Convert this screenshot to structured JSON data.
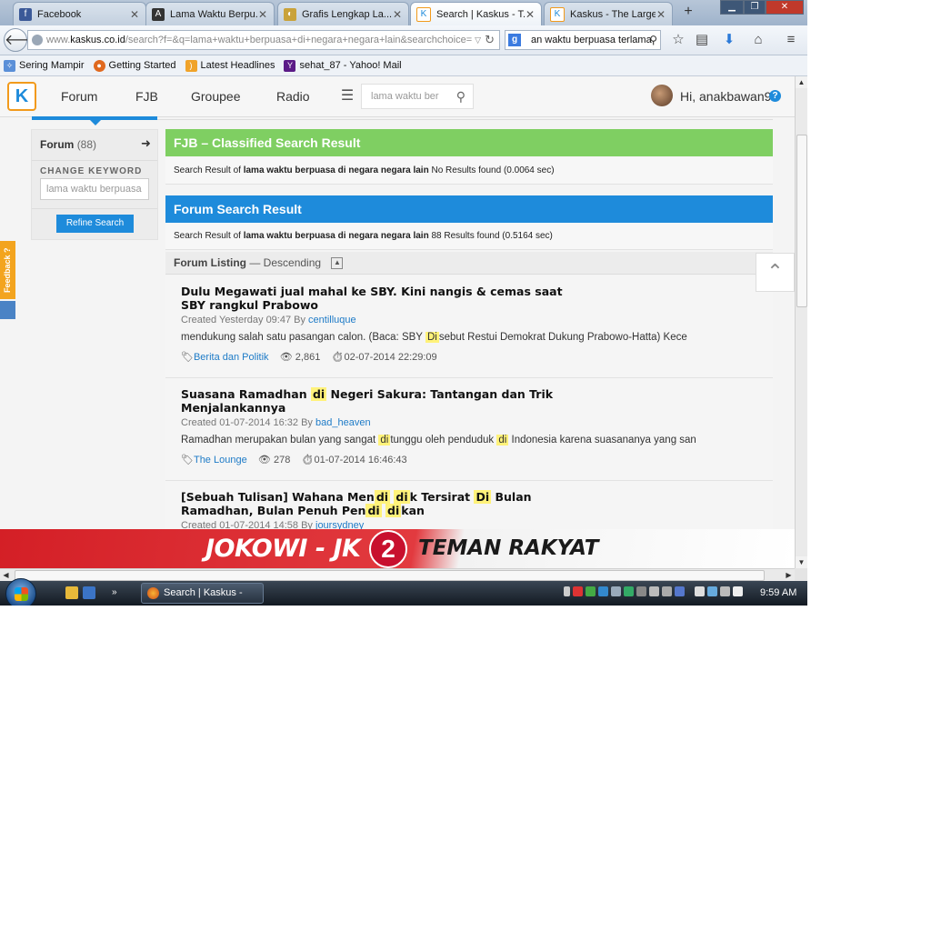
{
  "browser": {
    "tabs": [
      {
        "label": "Facebook",
        "icon": "facebook-icon",
        "active": false
      },
      {
        "label": "Lama Waktu Berpu...",
        "icon": "page-icon",
        "active": false
      },
      {
        "label": "Grafis Lengkap La...",
        "icon": "page-icon",
        "active": false
      },
      {
        "label": "Search | Kaskus - T...",
        "icon": "kaskus-icon",
        "active": true
      },
      {
        "label": "Kaskus - The Large...",
        "icon": "kaskus-icon",
        "active": false
      }
    ],
    "new_tab": "+",
    "url": {
      "prefix": "www.",
      "domain": "kaskus.co.id",
      "path": "/search?f=&q=lama+waktu+berpuasa+di+negara+negara+lain&searchchoice="
    },
    "search_value": "an waktu berpuasa terlama",
    "bookmarks": [
      "Sering Mampir",
      "Getting Started",
      "Latest Headlines",
      "sehat_87 - Yahoo! Mail"
    ]
  },
  "kaskus": {
    "nav": [
      "Forum",
      "FJB",
      "Groupee",
      "Radio"
    ],
    "search_placeholder": "lama waktu ber",
    "user_greeting": "Hi, anakbawan9",
    "help": "?"
  },
  "sidebar": {
    "forum_label": "Forum",
    "forum_count": "(88)",
    "change_keyword": "CHANGE KEYWORD",
    "keyword_value": "lama waktu berpuasa",
    "refine_button": "Refine Search"
  },
  "fjb": {
    "title": "FJB – Classified Search Result",
    "result_prefix": "Search Result of",
    "query": "lama waktu berpuasa di negara negara lain",
    "result_suffix": "No Results found (0.0064 sec)",
    "color": "#7fcf62"
  },
  "forum": {
    "title": "Forum Search Result",
    "result_prefix": "Search Result of",
    "query": "lama waktu berpuasa di negara negara lain",
    "result_suffix": "88 Results found (0.5164 sec)",
    "color": "#1e8bdb",
    "listing_label": "Forum Listing",
    "listing_order": "— Descending"
  },
  "results": [
    {
      "title": "Dulu Megawati jual mahal ke SBY. Kini nangis & cemas saat SBY rangkul Prabowo",
      "created": "Created Yesterday 09:47 By",
      "author": "centilluque",
      "snippet_before": "mendukung salah satu pasangan calon. (Baca: SBY ",
      "snippet_hl": "Di",
      "snippet_after": "sebut Restui Demokrat Dukung Prabowo-Hatta) Kece",
      "category": "Berita dan Politik",
      "views": "2,861",
      "date": "02-07-2014 22:29:09"
    },
    {
      "title_before": "Suasana Ramadhan ",
      "title_hl": "di",
      "title_after": " Negeri Sakura: Tantangan dan Trik Menjalankannya",
      "created": "Created 01-07-2014 16:32 By",
      "author": "bad_heaven",
      "snippet_a": "Ramadhan merupakan bulan yang sangat ",
      "snippet_hl1": "di",
      "snippet_b": "tunggu oleh penduduk ",
      "snippet_hl2": "di",
      "snippet_c": " Indonesia karena suasananya yang san",
      "category": "The Lounge",
      "views": "278",
      "date": "01-07-2014 16:46:43"
    },
    {
      "t1": "[Sebuah Tulisan] Wahana Men",
      "h1": "di",
      "h2": "di",
      "t2": "k Tersirat ",
      "h3": "Di",
      "t3": " Bulan Ramadhan, Bulan Penuh Pen",
      "h4": "di",
      "h5": "di",
      "t4": "kan",
      "created": "Created 01-07-2014 14:58 By",
      "author": "joursydney"
    }
  ],
  "feedback": "Feedback ?",
  "banner": {
    "left": "JOKOWI - JK",
    "number": "2",
    "right": "TEMAN RAKYAT"
  },
  "taskbar": {
    "task": "Search | Kaskus - Th...",
    "clock": "9:59 AM"
  }
}
